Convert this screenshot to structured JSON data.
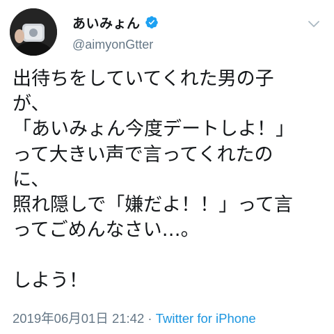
{
  "tweet": {
    "author": {
      "display_name": "あいみょん",
      "handle": "@aimyonGtter",
      "verified": true
    },
    "text": "出待ちをしていてくれた男の子\nが、\n「あいみょん今度デートしよ！」\nって大きい声で言ってくれたの\nに、\n照れ隠しで「嫌だよ！！」って言\nってごめんなさい…。\n\nしよう！",
    "timestamp": "2019年06月01日 21:42",
    "separator": " · ",
    "source": "Twitter for iPhone"
  },
  "colors": {
    "text": "#14171a",
    "secondary": "#657786",
    "link": "#1b95e0",
    "verified": "#1da1f2"
  },
  "icons": {
    "verified": "verified-badge-icon",
    "menu": "chevron-down-icon"
  }
}
